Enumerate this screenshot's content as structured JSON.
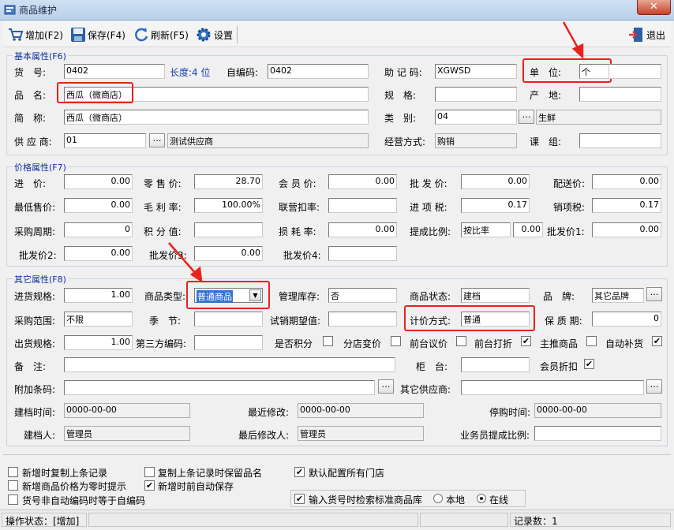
{
  "window": {
    "title": "商品维护",
    "close_label": "✕"
  },
  "toolbar": {
    "add": "增加(F2)",
    "save": "保存(F4)",
    "refresh": "刷新(F5)",
    "settings": "设置",
    "exit": "退出"
  },
  "basic": {
    "title": "基本属性(F6)",
    "code_label": "货　号:",
    "code_value": "0402",
    "length_label": "长度:4 位",
    "selfcode_label": "自编码:",
    "selfcode_value": "0402",
    "mnemonic_label": "助 记 码:",
    "mnemonic_value": "XGWSD",
    "unit_label": "单　位:",
    "unit_value": "个",
    "name_label": "品　名:",
    "name_value": "西瓜（微商店）",
    "spec_label": "规　格:",
    "spec_value": "",
    "origin_label": "产　地:",
    "origin_value": "",
    "short_label": "简　称:",
    "short_value": "西瓜（微商店）",
    "category_label": "类　别:",
    "category_value": "04",
    "category_name": "生鲜",
    "supplier_label": "供 应 商:",
    "supplier_value": "01",
    "supplier_name": "测试供应商",
    "mode_label": "经营方式:",
    "mode_value": "购销",
    "group_label": "课　组:",
    "group_value": ""
  },
  "price": {
    "title": "价格属性(F7)",
    "purchase_label": "进　价:",
    "purchase_value": "0.00",
    "retail_label": "零 售 价:",
    "retail_value": "28.70",
    "member_label": "会 员 价:",
    "member_value": "0.00",
    "wholesale_label": "批 发 价:",
    "wholesale_value": "0.00",
    "delivery_label": "配送价:",
    "delivery_value": "0.00",
    "min_label": "最低售价:",
    "min_value": "0.00",
    "margin_label": "毛 利 率:",
    "margin_value": "100.00%",
    "joint_label": "联营扣率:",
    "joint_value": "",
    "intax_label": "进 项 税:",
    "intax_value": "0.17",
    "outtax_label": "销项税:",
    "outtax_value": "0.17",
    "cycle_label": "采购周期:",
    "cycle_value": "0",
    "points_label": "积 分 值:",
    "points_value": "",
    "loss_label": "损 耗 率:",
    "loss_value": "0.00",
    "commission_label": "提成比例:",
    "commission_mode": "按比率",
    "commission_value": "0.00",
    "wholesale1_label": "批发价1:",
    "wholesale1_value": "0.00",
    "wholesale2_label": "批发价2:",
    "wholesale2_value": "0.00",
    "wholesale3_label": "批发价3:",
    "wholesale3_value": "0.00",
    "wholesale4_label": "批发价4:",
    "wholesale4_value": ""
  },
  "other": {
    "title": "其它属性(F8)",
    "inspec_label": "进货规格:",
    "inspec_value": "1.00",
    "type_label": "商品类型:",
    "type_value": "普通商品",
    "stockmgmt_label": "管理库存:",
    "stockmgmt_value": "否",
    "status_label": "商品状态:",
    "status_value": "建档",
    "brand_label": "品　牌:",
    "brand_value": "其它品牌",
    "scope_label": "采购范围:",
    "scope_value": "不限",
    "season_label": "季　节:",
    "season_value": "",
    "trial_label": "试销期望值:",
    "trial_value": "",
    "pricing_label": "计价方式:",
    "pricing_value": "普通",
    "shelf_label": "保 质 期:",
    "shelf_value": "0",
    "outspec_label": "出货规格:",
    "outspec_value": "1.00",
    "thirdcode_label": "第三方编码:",
    "thirdcode_value": "",
    "chk_points": "是否积分",
    "chk_branch_price": "分店变价",
    "chk_front_bargain": "前台议价",
    "chk_front_discount": "前台打折",
    "chk_promote": "主推商品",
    "chk_auto_replenish": "自动补货",
    "remark_label": "备　注:",
    "remark_value": "",
    "counter_label": "柜　台:",
    "counter_value": "",
    "member_discount": "会员折扣",
    "extra_barcode_label": "附加条码:",
    "extra_barcode_value": "",
    "other_supplier_label": "其它供应商:",
    "other_supplier_value": "",
    "created_label": "建档时间:",
    "created_value": "0000-00-00",
    "modified_label": "最近修改:",
    "modified_value": "0000-00-00",
    "stopsale_label": "停购时间:",
    "stopsale_value": "0000-00-00",
    "creator_label": "建档人:",
    "creator_value": "管理员",
    "modifier_label": "最后修改人:",
    "modifier_value": "管理员",
    "staff_commission_label": "业务员提成比例:",
    "staff_commission_value": ""
  },
  "options": {
    "copy_last": "新增时复制上条记录",
    "copy_keep_name": "复制上条记录时保留品名",
    "default_all_stores": "默认配置所有门店",
    "zero_price_prompt": "新增商品价格为零时提示",
    "auto_save": "新增时前自动保存",
    "code_equals_self": "货号非自动编码时等于自编码",
    "retrieve_std": "输入货号时检索标准商品库",
    "local": "本地",
    "online": "在线"
  },
  "statusbar": {
    "op_status": "操作状态：[增加]",
    "record_count": "记录数：1"
  }
}
